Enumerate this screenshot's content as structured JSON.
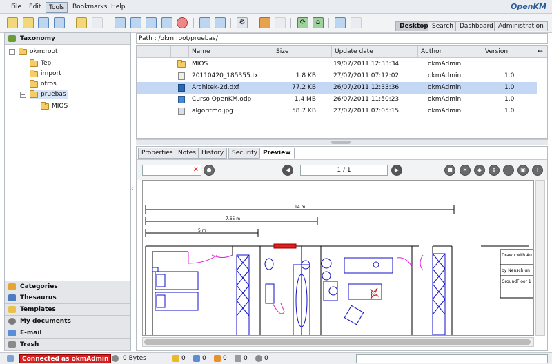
{
  "menu": {
    "items": [
      "File",
      "Edit",
      "Tools",
      "Bookmarks",
      "Help"
    ],
    "active": "Tools"
  },
  "logo": "OpenKM",
  "top_tabs": [
    "Desktop",
    "Search",
    "Dashboard",
    "Administration"
  ],
  "top_tabs_active": "Desktop",
  "left": {
    "taxonomy_title": "Taxonomy",
    "tree": [
      {
        "label": "okm:root",
        "toggle": "−"
      },
      {
        "label": "Tep"
      },
      {
        "label": "import"
      },
      {
        "label": "otros"
      },
      {
        "label": "pruebas",
        "toggle": "−"
      },
      {
        "label": "MIOS"
      }
    ],
    "sections": [
      "Categories",
      "Thesaurus",
      "Templates",
      "My documents",
      "E-mail",
      "Trash"
    ]
  },
  "path": "Path : /okm:root/pruebas/",
  "table": {
    "headers": [
      "Name",
      "Size",
      "Update date",
      "Author",
      "Version"
    ],
    "rows": [
      {
        "icon": "folder-icon",
        "name": "MIOS",
        "size": "",
        "date": "19/07/2011 12:33:34",
        "author": "okmAdmin",
        "version": ""
      },
      {
        "icon": "text-file-icon",
        "name": "20110420_185355.txt",
        "size": "1.8 KB",
        "date": "27/07/2011 07:12:02",
        "author": "okmAdmin",
        "version": "1.0"
      },
      {
        "icon": "dxf-file-icon",
        "name": "Architek-2d.dxf",
        "size": "77.2 KB",
        "date": "26/07/2011 12:33:36",
        "author": "okmAdmin",
        "version": "1.0"
      },
      {
        "icon": "odp-file-icon",
        "name": "Curso OpenKM.odp",
        "size": "1.4 MB",
        "date": "26/07/2011 11:50:23",
        "author": "okmAdmin",
        "version": "1.0"
      },
      {
        "icon": "image-file-icon",
        "name": "algoritmo.jpg",
        "size": "58.7 KB",
        "date": "27/07/2011 07:05:15",
        "author": "okmAdmin",
        "version": "1.0"
      }
    ],
    "selected_row": 2
  },
  "preview": {
    "tabs": [
      "Properties",
      "Notes",
      "History",
      "Security",
      "Preview"
    ],
    "active_tab": "Preview",
    "page": "1 / 1",
    "drawing_labels": {
      "dim1": "14 m",
      "dim2": "7.65 m",
      "dim3": "5 m",
      "title1": "Drawn with Au",
      "title2": "by Nensch un",
      "title3": "GroundFloor 1"
    }
  },
  "status": {
    "connected": "Connected as okmAdmin",
    "bytes": "0 Bytes",
    "counts": [
      "0",
      "0",
      "0",
      "0",
      "0"
    ]
  },
  "colors": {
    "selection": "#c4d8f5",
    "connected_bg": "#d62020",
    "plan_blue": "#1010c8",
    "plan_magenta": "#e020e0"
  }
}
